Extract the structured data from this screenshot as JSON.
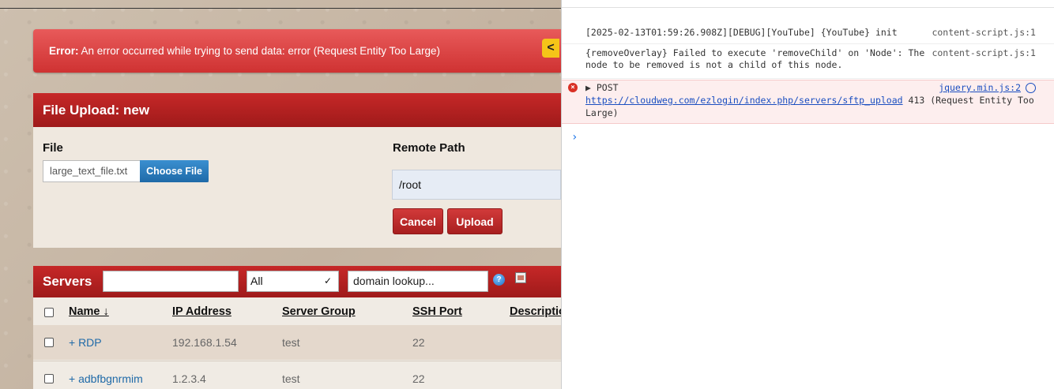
{
  "error_bar": {
    "label": "Error:",
    "message": "An error occurred while trying to send data: error (Request Entity Too Large)",
    "collapse_glyph": "<"
  },
  "upload": {
    "title": "File Upload: new",
    "file_label": "File",
    "file_value": "large_text_file.txt",
    "choose_label": "Choose File",
    "path_label": "Remote Path",
    "path_value": "/root",
    "cancel_label": "Cancel",
    "upload_label": "Upload"
  },
  "servers": {
    "title": "Servers",
    "group_select": "All",
    "domain_lookup": "domain lookup...",
    "columns": [
      "Name ↓",
      "IP Address",
      "Server Group",
      "SSH Port",
      "Descriptio"
    ],
    "rows": [
      {
        "name": "+ RDP",
        "ip": "192.168.1.54",
        "group": "test",
        "port": "22"
      },
      {
        "name": "+ adbfbgnrmim",
        "ip": "1.2.3.4",
        "group": "test",
        "port": "22"
      }
    ]
  },
  "console": {
    "messages": [
      {
        "text": "[2025-02-13T01:59:26.908Z][DEBUG][YouTube] {YouTube} init",
        "source": "content-script.js:1"
      },
      {
        "text1": "{removeOverlay} Failed to execute 'removeChild' on 'Node': The",
        "text2": "node to be removed is not a child of this node.",
        "source": "content-script.js:1"
      },
      {
        "method": "▶ POST",
        "url": "https://cloudweg.com/ezlogin/index.php/servers/sftp_upload",
        "status": "413 (Request Entity Too",
        "status2": "Large)",
        "source": "jquery.min.js:2"
      }
    ],
    "prompt": "›"
  },
  "icons": {
    "error": "error-circle-icon",
    "help": "help-icon",
    "network": "network-icon"
  },
  "colors": {
    "error_bar": "#d93a3a",
    "panel_header": "#b22222",
    "primary_button": "#1f6aa8"
  }
}
